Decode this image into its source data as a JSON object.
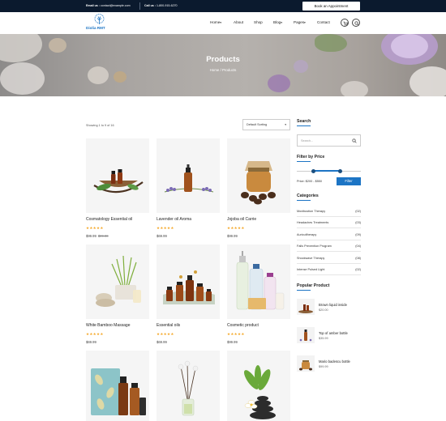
{
  "topbar": {
    "email_label": "Email us :",
    "email": "contact@example.com",
    "call_label": "Call us :",
    "phone": "1-800-915-6270",
    "appointment_button": "Book an Appointment"
  },
  "header": {
    "logo_text": "Diolia RMT",
    "nav": [
      {
        "label": "Home",
        "has_dropdown": true
      },
      {
        "label": "About",
        "has_dropdown": false
      },
      {
        "label": "Shop",
        "has_dropdown": false
      },
      {
        "label": "Blog",
        "has_dropdown": true
      },
      {
        "label": "Pages",
        "has_dropdown": true
      },
      {
        "label": "Contact",
        "has_dropdown": false
      }
    ],
    "icons": [
      "cart-icon",
      "search-icon"
    ],
    "caret": "▾"
  },
  "banner": {
    "title": "Products",
    "breadcrumb": "Home / Products"
  },
  "shop": {
    "showing_text": "Showing 1 to 9 of 16",
    "sort_value": "Default Sorting",
    "sort_arrow": "▾"
  },
  "products": [
    {
      "name": "Cosmatology Essential oil",
      "stars": "★★★★★",
      "price": "$99.99",
      "old_price": "$99.00"
    },
    {
      "name": "Lavender oil Aroma",
      "stars": "★★★★★",
      "price": "$69.99",
      "old_price": ""
    },
    {
      "name": "Jojoba oil Carrie",
      "stars": "★★★★★",
      "price": "$99.99",
      "old_price": ""
    },
    {
      "name": "White Bamboo Massage",
      "stars": "★★★★★",
      "price": "$69.99",
      "old_price": ""
    },
    {
      "name": "Essential oils",
      "stars": "★★★★★",
      "price": "$69.99",
      "old_price": ""
    },
    {
      "name": "Cosmetic product",
      "stars": "★★★★★",
      "price": "$99.99",
      "old_price": ""
    },
    {
      "name": "",
      "stars": "",
      "price": "",
      "old_price": ""
    },
    {
      "name": "",
      "stars": "",
      "price": "",
      "old_price": ""
    },
    {
      "name": "",
      "stars": "",
      "price": "",
      "old_price": ""
    }
  ],
  "sidebar": {
    "search_title": "Search",
    "search_placeholder": "Search...",
    "filter_title": "Filter by Price",
    "price_range": "Price: $200 - $550",
    "price_min_fraction": 0.25,
    "price_max_fraction": 0.68,
    "filter_button": "Filter",
    "categories_title": "Categories",
    "categories": [
      {
        "name": "Moxibustion Therapy",
        "count": "(02)"
      },
      {
        "name": "Headaches Treatments",
        "count": "(03)"
      },
      {
        "name": "Auricultherapy",
        "count": "(09)"
      },
      {
        "name": "Falls Prevention Program",
        "count": "(04)"
      },
      {
        "name": "Shockwave Therapy",
        "count": "(08)"
      },
      {
        "name": "Intense Pulsed Light",
        "count": "(02)"
      }
    ],
    "popular_title": "Popular Product",
    "popular": [
      {
        "name": "Brown liquid inside",
        "price": "$20.00"
      },
      {
        "name": "Top of amber bottle",
        "price": "$35.99"
      },
      {
        "name": "Mario badescu bottle",
        "price": "$99.99"
      }
    ]
  },
  "colors": {
    "accent": "#1c74c4",
    "topbar_bg": "#0b1a2e",
    "star": "#f5a623"
  }
}
